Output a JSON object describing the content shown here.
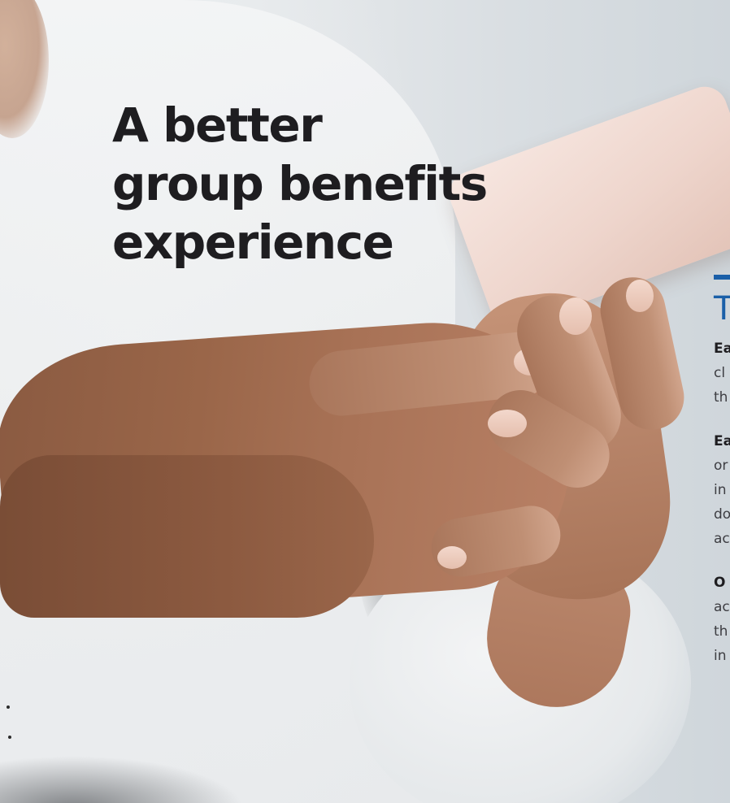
{
  "headline": {
    "lines": [
      "A better",
      "group benefits",
      "experience"
    ]
  },
  "side_panel": {
    "heading": "T",
    "items": [
      {
        "title": "Ea",
        "lines": [
          "cl",
          "th"
        ]
      },
      {
        "title": "Ea",
        "lines": [
          "or",
          "in",
          "do",
          "ac"
        ]
      },
      {
        "title": "O",
        "lines": [
          "ac",
          "th",
          "in"
        ]
      }
    ]
  },
  "colors": {
    "accent": "#1a5fa8",
    "headline_text": "#1e1d20"
  }
}
